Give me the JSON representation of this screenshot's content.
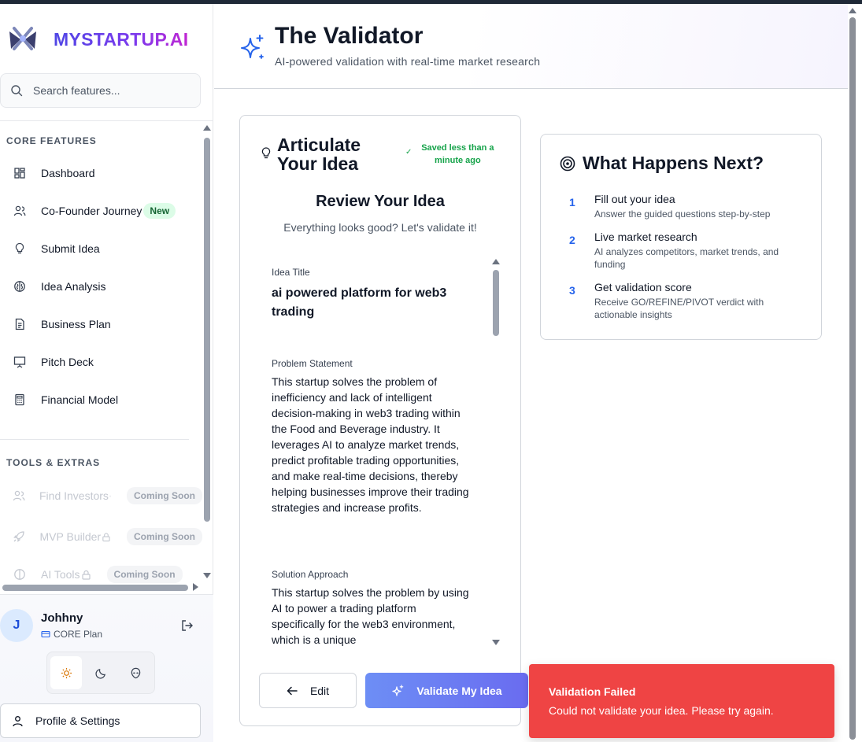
{
  "brand": {
    "name": "MYSTARTUP.AI"
  },
  "search": {
    "placeholder": "Search features..."
  },
  "sidebar": {
    "core_title": "CORE FEATURES",
    "core_items": [
      {
        "label": "Dashboard",
        "icon": "dashboard-icon"
      },
      {
        "label": "Co-Founder Journey",
        "icon": "users-icon",
        "badge": "New"
      },
      {
        "label": "Submit Idea",
        "icon": "lightbulb-icon"
      },
      {
        "label": "Idea Analysis",
        "icon": "brain-icon"
      },
      {
        "label": "Business Plan",
        "icon": "document-icon"
      },
      {
        "label": "Pitch Deck",
        "icon": "presentation-icon"
      },
      {
        "label": "Financial Model",
        "icon": "calculator-icon"
      }
    ],
    "tools_title": "TOOLS & EXTRAS",
    "tools_items": [
      {
        "label": "Find Investors",
        "icon": "users-icon",
        "badge": "Coming Soon"
      },
      {
        "label": "MVP Builder",
        "icon": "rocket-icon",
        "badge": "Coming Soon"
      },
      {
        "label": "AI Tools",
        "icon": "brain-icon",
        "badge": "Coming Soon"
      }
    ]
  },
  "user": {
    "initial": "J",
    "name": "Johhny",
    "plan": "CORE Plan"
  },
  "profile": {
    "label": "Profile & Settings"
  },
  "header": {
    "title": "The Validator",
    "subtitle": "AI-powered validation with real-time market research"
  },
  "articulate": {
    "title": "Articulate Your Idea",
    "saved": "Saved less than a minute ago",
    "review_title": "Review Your Idea",
    "review_sub": "Everything looks good? Let's validate it!",
    "fields": [
      {
        "label": "Idea Title",
        "value": "ai powered platform for web3 trading"
      },
      {
        "label": "Problem Statement",
        "value": "This startup solves the problem of inefficiency and lack of intelligent decision-making in web3 trading within the Food and Beverage industry. It leverages AI to analyze market trends, predict profitable trading opportunities, and make real-time decisions, thereby helping businesses improve their trading strategies and increase profits."
      },
      {
        "label": "Solution Approach",
        "value": "This startup solves the problem by using AI to power a trading platform specifically for the web3 environment, which is a unique"
      }
    ],
    "edit_label": "Edit",
    "validate_label": "Validate My Idea"
  },
  "next": {
    "title": "What Happens Next?",
    "steps": [
      {
        "num": "1",
        "title": "Fill out your idea",
        "desc": "Answer the guided questions step-by-step"
      },
      {
        "num": "2",
        "title": "Live market research",
        "desc": "AI analyzes competitors, market trends, and funding"
      },
      {
        "num": "3",
        "title": "Get validation score",
        "desc": "Receive GO/REFINE/PIVOT verdict with actionable insights"
      }
    ]
  },
  "toast": {
    "title": "Validation Failed",
    "message": "Could not validate your idea. Please try again."
  },
  "colors": {
    "accent": "#6a6cf0",
    "error": "#ef4444",
    "success": "#16a34a",
    "step_number": "#2563eb"
  }
}
